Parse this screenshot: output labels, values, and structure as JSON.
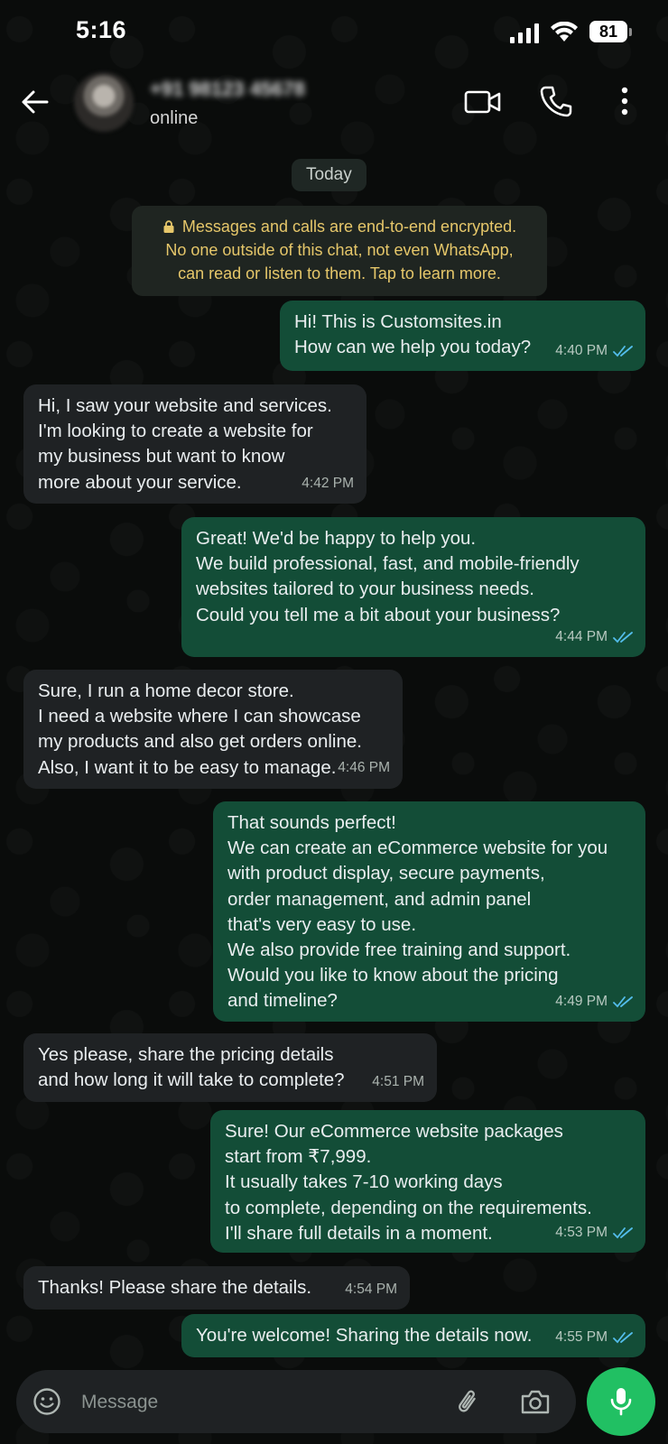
{
  "status_bar": {
    "time": "5:16",
    "battery": "81"
  },
  "header": {
    "contact_name": "+91 98123 45678",
    "status": "online",
    "icons": [
      "back-arrow-icon",
      "video-call-icon",
      "phone-icon",
      "more-vert-icon"
    ]
  },
  "chat": {
    "date_chip": "Today",
    "encryption_notice": "Messages and calls are end-to-end encrypted.\nNo one outside of this chat, not even WhatsApp,\ncan read or listen to them. Tap to learn more.",
    "messages": [
      {
        "direction": "out",
        "text": "Hi! This is Customsites.in\nHow can we help you today?",
        "time": "4:40 PM"
      },
      {
        "direction": "in",
        "text": "Hi, I saw your website and services.\nI'm looking to create a website for\nmy business but want to know\nmore about your service.",
        "time": "4:42 PM"
      },
      {
        "direction": "out",
        "text": "Great! We'd be happy to help you.\nWe build professional, fast, and mobile-friendly\nwebsites tailored to your business needs.\nCould you tell me a bit about your business?",
        "time": "4:44 PM"
      },
      {
        "direction": "in",
        "text": "Sure, I run a home decor store.\nI need a website where I can showcase\nmy products and also get orders online.\nAlso, I want it to be easy to manage.",
        "time": "4:46 PM"
      },
      {
        "direction": "out",
        "text": "That sounds perfect!\nWe can create an eCommerce website for you\nwith product display, secure payments,\norder management, and admin panel\nthat's very easy to use.\nWe also provide free training and support.\nWould you like to know about the pricing\nand timeline?",
        "time": "4:49 PM"
      },
      {
        "direction": "in",
        "text": "Yes please, share the pricing details\nand how long it will take to complete?",
        "time": "4:51 PM"
      },
      {
        "direction": "out",
        "text": "Sure! Our eCommerce website packages\nstart from ₹7,999.\nIt usually takes 7-10 working days\nto complete, depending on the requirements.\nI'll share full details in a moment.",
        "time": "4:53 PM"
      },
      {
        "direction": "in",
        "text": "Thanks! Please share the details.",
        "time": "4:54 PM"
      },
      {
        "direction": "out",
        "text": "You're welcome! Sharing the details now.",
        "time": "4:55 PM"
      }
    ]
  },
  "input_bar": {
    "placeholder": "Message",
    "icons": [
      "emoji-icon",
      "attach-icon",
      "camera-icon",
      "mic-icon"
    ]
  },
  "colors": {
    "background": "#0a0c0b",
    "incoming_bubble": "#1f2224",
    "outgoing_bubble": "#134d37",
    "read_ticks": "#53bdeb",
    "notice_text": "#e6c76a",
    "mic_button": "#21c063"
  }
}
